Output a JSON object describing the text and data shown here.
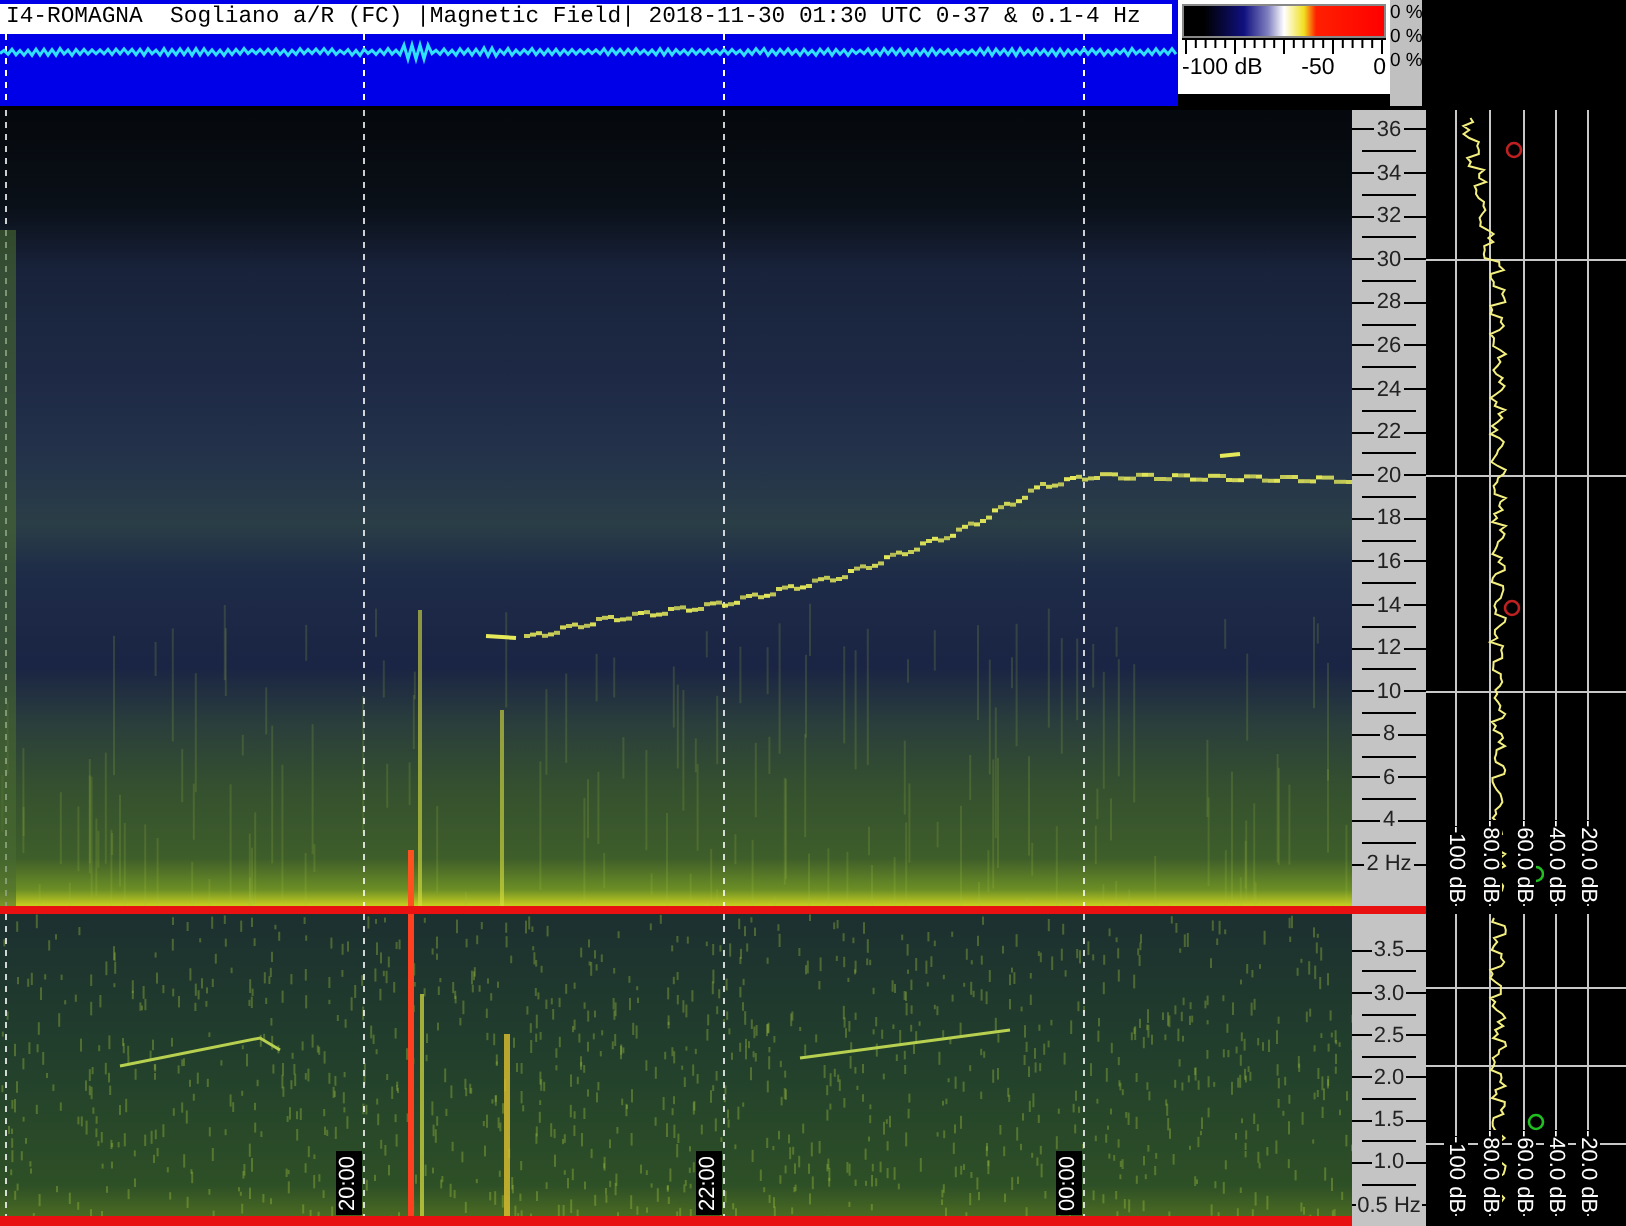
{
  "title": "I4-ROMAGNA  Sogliano a/R (FC) |Magnetic Field| 2018-11-30 01:30 UTC 0-37 & 0.1-4 Hz",
  "color_scale": {
    "labels": [
      "-100 dB",
      "-50",
      "0"
    ],
    "percents": [
      "0 %",
      "0 %",
      "0 %"
    ]
  },
  "upper_panel": {
    "freq_labels": [
      "36",
      "34",
      "32",
      "30",
      "28",
      "26",
      "24",
      "22",
      "20",
      "18",
      "16",
      "14",
      "12",
      "10",
      "8",
      "6",
      "4",
      "2 Hz"
    ],
    "db_labels": [
      "-100 dB",
      "-80.0 dB",
      "-60.0 dB",
      "-40.0 dB",
      "-20.0 dB"
    ]
  },
  "lower_panel": {
    "freq_labels": [
      "3.5",
      "3.0",
      "2.5",
      "2.0",
      "1.5",
      "1.0",
      "0.5 Hz"
    ],
    "db_labels": [
      "-100 dB",
      "-80.0 dB",
      "-60.0 dB",
      "-40.0 dB",
      "-20.0 dB"
    ]
  },
  "time_labels": [
    "20:00",
    "22:00",
    "00:00"
  ]
}
